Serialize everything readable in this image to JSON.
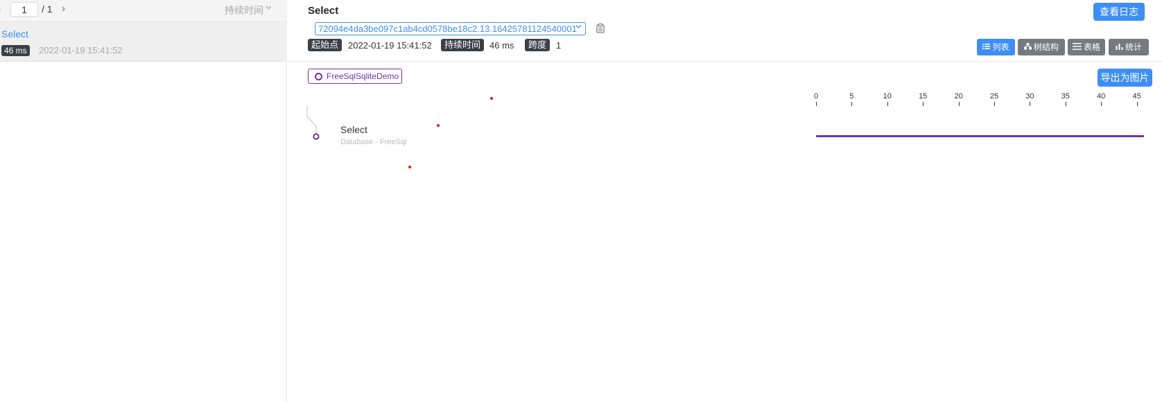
{
  "pager": {
    "prev": "‹",
    "page": "1",
    "total": "/ 1",
    "next": "›",
    "sort_label": "持续时间"
  },
  "trace_list": [
    {
      "name": "Select",
      "duration": "46 ms",
      "time": "2022-01-19 15:41:52"
    }
  ],
  "header": {
    "title": "Select",
    "log_button": "查看日志",
    "trace_id": "72094e4da3be097c1ab4cd0578be18c2.13.16425781124540001",
    "start_label": "起始点",
    "start_value": "2022-01-19 15:41:52",
    "duration_label": "持续时间",
    "duration_value": "46 ms",
    "span_label": "跨度",
    "span_value": "1"
  },
  "views": [
    {
      "label": "列表",
      "icon": "list-icon",
      "active": true
    },
    {
      "label": "树结构",
      "icon": "tree-icon",
      "active": false
    },
    {
      "label": "表格",
      "icon": "table-icon",
      "active": false
    },
    {
      "label": "统计",
      "icon": "bar-chart-icon",
      "active": false
    }
  ],
  "service": "FreeSqlSqliteDemo",
  "export_button": "导出为图片",
  "axis_ticks": [
    "0",
    "5",
    "10",
    "15",
    "20",
    "25",
    "30",
    "35",
    "40",
    "45"
  ],
  "span": {
    "name": "Select",
    "subtitle": "Database - FreeSql",
    "start_ms": 0,
    "duration_ms": 46
  },
  "colors": {
    "accent": "#3d8ff5",
    "service": "#6e35a6",
    "tag_bg": "#3a3f48",
    "button_gray": "#77797e"
  }
}
